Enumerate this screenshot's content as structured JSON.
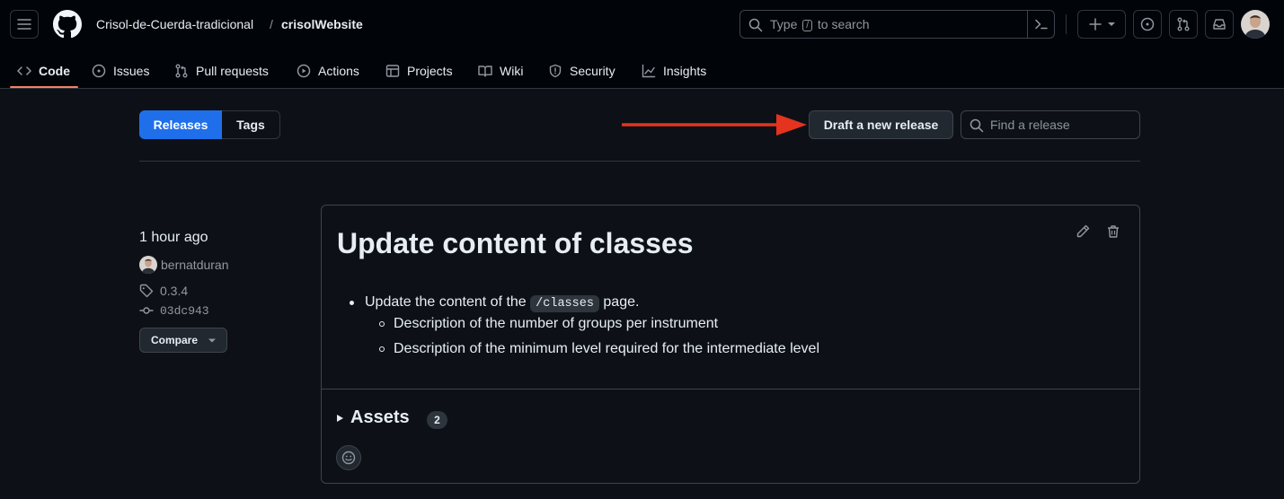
{
  "header": {
    "owner": "Crisol-de-Cuerda-tradicional",
    "separator": "/",
    "repo": "crisolWebsite",
    "search": {
      "prefix": "Type",
      "key": "/",
      "suffix": "to search"
    }
  },
  "nav": {
    "tabs": [
      {
        "label": "Code",
        "icon": "code-icon",
        "active": true
      },
      {
        "label": "Issues",
        "icon": "issue-opened-icon"
      },
      {
        "label": "Pull requests",
        "icon": "git-pull-request-icon"
      },
      {
        "label": "Actions",
        "icon": "play-icon"
      },
      {
        "label": "Projects",
        "icon": "table-icon"
      },
      {
        "label": "Wiki",
        "icon": "book-icon"
      },
      {
        "label": "Security",
        "icon": "shield-icon"
      },
      {
        "label": "Insights",
        "icon": "graph-icon"
      }
    ]
  },
  "toolbar": {
    "releases_tab": "Releases",
    "tags_tab": "Tags",
    "draft_button": "Draft a new release",
    "find_placeholder": "Find a release"
  },
  "release": {
    "time": "1 hour ago",
    "author": "bernatduran",
    "tag": "0.3.4",
    "commit": "03dc943",
    "compare_label": "Compare",
    "title": "Update content of classes",
    "notes": {
      "item_prefix": "Update the content of the",
      "item_code": "/classes",
      "item_suffix": "page.",
      "subitems": [
        "Description of the number of groups per instrument",
        "Description of the minimum level required for the intermediate level"
      ]
    },
    "assets_label": "Assets",
    "assets_count": "2"
  },
  "colors": {
    "background": "#0d1117",
    "header_bg": "#010409",
    "accent_blue": "#1f6feb",
    "tab_underline": "#f78166",
    "annotation_arrow": "#e5331f"
  }
}
